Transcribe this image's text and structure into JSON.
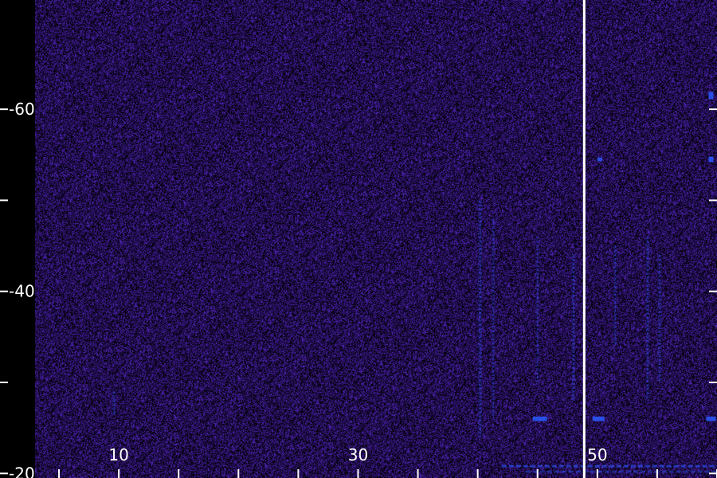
{
  "chart_data": {
    "type": "heatmap",
    "title": "",
    "xlabel": "",
    "ylabel": "",
    "x_ticks": [
      {
        "value": 10,
        "label": "10"
      },
      {
        "value": 30,
        "label": "30"
      },
      {
        "value": 50,
        "label": "50"
      }
    ],
    "y_ticks": [
      {
        "value": 20,
        "label": "-20"
      },
      {
        "value": 40,
        "label": "-40"
      },
      {
        "value": 60,
        "label": "-60"
      }
    ],
    "x_minor_ticks": [
      5,
      10,
      15,
      20,
      25,
      30,
      35,
      40,
      45,
      50,
      55,
      60
    ],
    "y_minor_ticks": [
      20,
      30,
      40,
      50,
      60
    ],
    "xlim": [
      3,
      60
    ],
    "ylim": [
      19.5,
      72
    ],
    "marker_line_x": 48.9,
    "colors": {
      "background": "#000000",
      "noise_low": "#1a0840",
      "noise_mid": "#3a1a8a",
      "noise_high": "#5a30c0",
      "feature": "#2a5aff",
      "marker": "#ffffff",
      "text": "#ffffff"
    },
    "vertical_streaks": [
      {
        "x": 40.2,
        "y_from": 24,
        "y_to": 50,
        "intensity": 0.55
      },
      {
        "x": 41.3,
        "y_from": 26,
        "y_to": 48,
        "intensity": 0.4
      },
      {
        "x": 45.0,
        "y_from": 30,
        "y_to": 46,
        "intensity": 0.4
      },
      {
        "x": 48.0,
        "y_from": 28,
        "y_to": 44,
        "intensity": 0.5
      },
      {
        "x": 51.5,
        "y_from": 34,
        "y_to": 45,
        "intensity": 0.45
      },
      {
        "x": 54.2,
        "y_from": 28,
        "y_to": 46,
        "intensity": 0.5
      },
      {
        "x": 55.2,
        "y_from": 30,
        "y_to": 44,
        "intensity": 0.45
      },
      {
        "x": 9.6,
        "y_from": 26.5,
        "y_to": 29,
        "intensity": 0.5
      }
    ],
    "spots": [
      {
        "x": 45.2,
        "y": 26,
        "w": 1.2,
        "h": 0.5
      },
      {
        "x": 50.1,
        "y": 26,
        "w": 1.0,
        "h": 0.5
      },
      {
        "x": 59.5,
        "y": 26,
        "w": 0.8,
        "h": 0.5
      },
      {
        "x": 59.5,
        "y": 54.5,
        "w": 0.4,
        "h": 0.6
      },
      {
        "x": 59.5,
        "y": 61.5,
        "w": 0.4,
        "h": 0.8
      },
      {
        "x": 50.2,
        "y": 54.5,
        "w": 0.4,
        "h": 0.4
      }
    ],
    "horizontal_bands": [
      {
        "y": 20.8,
        "x_from": 42,
        "x_to": 60,
        "intensity": 0.6
      },
      {
        "y": 20.2,
        "x_from": 44,
        "x_to": 60,
        "intensity": 0.4
      }
    ]
  }
}
